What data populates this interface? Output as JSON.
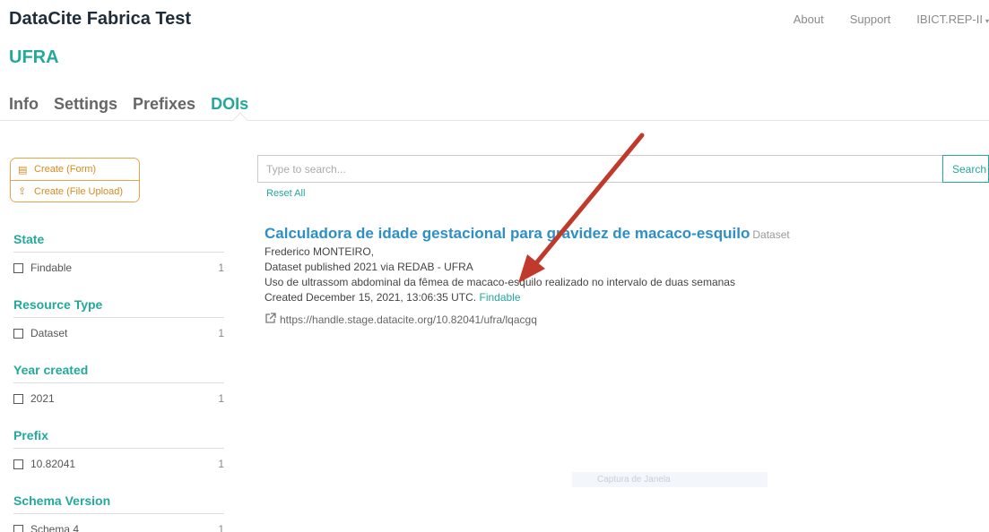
{
  "header": {
    "brand": "DataCite Fabrica Test",
    "nav": {
      "about": "About",
      "support": "Support",
      "user": "IBICT.REP-II"
    }
  },
  "org": {
    "name": "UFRA"
  },
  "tabs": [
    {
      "label": "Info"
    },
    {
      "label": "Settings"
    },
    {
      "label": "Prefixes"
    },
    {
      "label": "DOIs"
    }
  ],
  "actions": {
    "create_form": "Create (Form)",
    "create_upload": "Create (File Upload)"
  },
  "facets": {
    "state": {
      "title": "State",
      "item": "Findable",
      "count": "1"
    },
    "resource_type": {
      "title": "Resource Type",
      "item": "Dataset",
      "count": "1"
    },
    "year": {
      "title": "Year created",
      "item": "2021",
      "count": "1"
    },
    "prefix": {
      "title": "Prefix",
      "item": "10.82041",
      "count": "1"
    },
    "schema": {
      "title": "Schema Version",
      "item": "Schema 4",
      "count": "1"
    }
  },
  "search": {
    "placeholder": "Type to search...",
    "button": "Search",
    "reset": "Reset All"
  },
  "result": {
    "title": "Calculadora de idade gestacional para gravidez de macaco-esquilo",
    "type": "Dataset",
    "creator": "Frederico MONTEIRO,",
    "published": "Dataset published 2021 via REDAB - UFRA",
    "description": "Uso de ultrassom abdominal da fêmea de macaco-esquilo realizado no intervalo de duas semanas",
    "created": "Created December 15, 2021, 13:06:35 UTC.",
    "state": "Findable",
    "url": "https://handle.stage.datacite.org/10.82041/ufra/lqacgq"
  },
  "overlay": {
    "tooltip": "Captura de Janela"
  },
  "colors": {
    "accent": "#23a89b",
    "link": "#2e8fc7",
    "warning": "#e8a24a",
    "arrow": "#c0392b"
  },
  "icons": {
    "form": "form-icon",
    "upload": "upload-icon",
    "external": "external-link-icon"
  }
}
